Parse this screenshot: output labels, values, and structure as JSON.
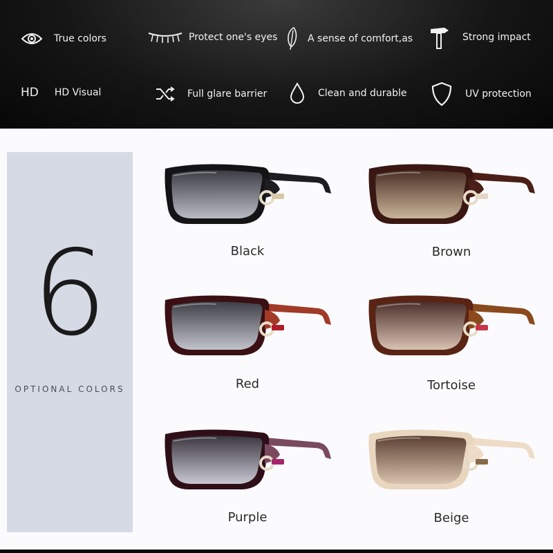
{
  "features": {
    "true_colors": {
      "label": "True colors",
      "icon": "eye-icon"
    },
    "protect_eyes": {
      "label": "Protect one's eyes",
      "icon": "eyelash-icon"
    },
    "comfort": {
      "label": "A sense of comfort,as",
      "icon": "feather-icon"
    },
    "strong_impact": {
      "label": "Strong impact",
      "icon": "hammer-icon"
    },
    "hd_visual": {
      "label": "HD Visual",
      "icon_text": "HD",
      "icon": "hd-icon"
    },
    "glare": {
      "label": "Full glare barrier",
      "icon": "shuffle-icon"
    },
    "clean": {
      "label": "Clean and durable",
      "icon": "drop-icon"
    },
    "uv": {
      "label": "UV protection",
      "icon": "shield-icon"
    }
  },
  "panel": {
    "count": "6",
    "caption": "OPTIONAL COLORS"
  },
  "colors": [
    {
      "name": "Black",
      "frame": "#141416",
      "temple": "#1d1d20",
      "lens_top": "#3c3c44",
      "lens_bottom": "#b9bbc4",
      "accent": "#d8c8a8"
    },
    {
      "name": "Brown",
      "frame": "#3a1712",
      "temple": "#4a1f17",
      "lens_top": "#4a2f25",
      "lens_bottom": "#c9b59a",
      "accent": "#e5d6c5"
    },
    {
      "name": "Red",
      "frame": "#3a1014",
      "temple": "#a23a28",
      "lens_top": "#3e3e46",
      "lens_bottom": "#c2c3cb",
      "accent": "#b11b2a"
    },
    {
      "name": "Tortoise",
      "frame": "#5a2414",
      "temple": "#8a4a1c",
      "lens_top": "#4b2e2a",
      "lens_bottom": "#d8c3b3",
      "accent": "#c8354a"
    },
    {
      "name": "Purple",
      "frame": "#2e0f18",
      "temple": "#7a4a5e",
      "lens_top": "#3a3640",
      "lens_bottom": "#c9c8d2",
      "accent": "#a8236e"
    },
    {
      "name": "Beige",
      "frame": "#e9d6bf",
      "temple": "#efdcc8",
      "lens_top": "#5b4033",
      "lens_bottom": "#d8c2ad",
      "accent": "#8a6a4a"
    }
  ]
}
